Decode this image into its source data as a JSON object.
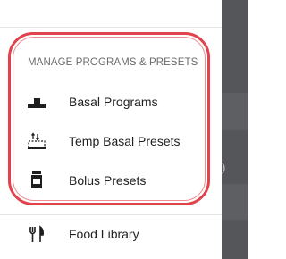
{
  "drawer": {
    "section": {
      "title": "MANAGE PROGRAMS & PRESETS",
      "items": [
        {
          "label": "Basal Programs",
          "icon": "basal-program-icon"
        },
        {
          "label": "Temp Basal Presets",
          "icon": "temp-basal-icon"
        },
        {
          "label": "Bolus Presets",
          "icon": "bolus-icon"
        }
      ]
    },
    "food_library": {
      "label": "Food Library",
      "icon": "fork-knife-icon"
    }
  },
  "background": {
    "partial_text": ")"
  },
  "colors": {
    "highlight": "#e0434b",
    "scrim": "#555659"
  }
}
